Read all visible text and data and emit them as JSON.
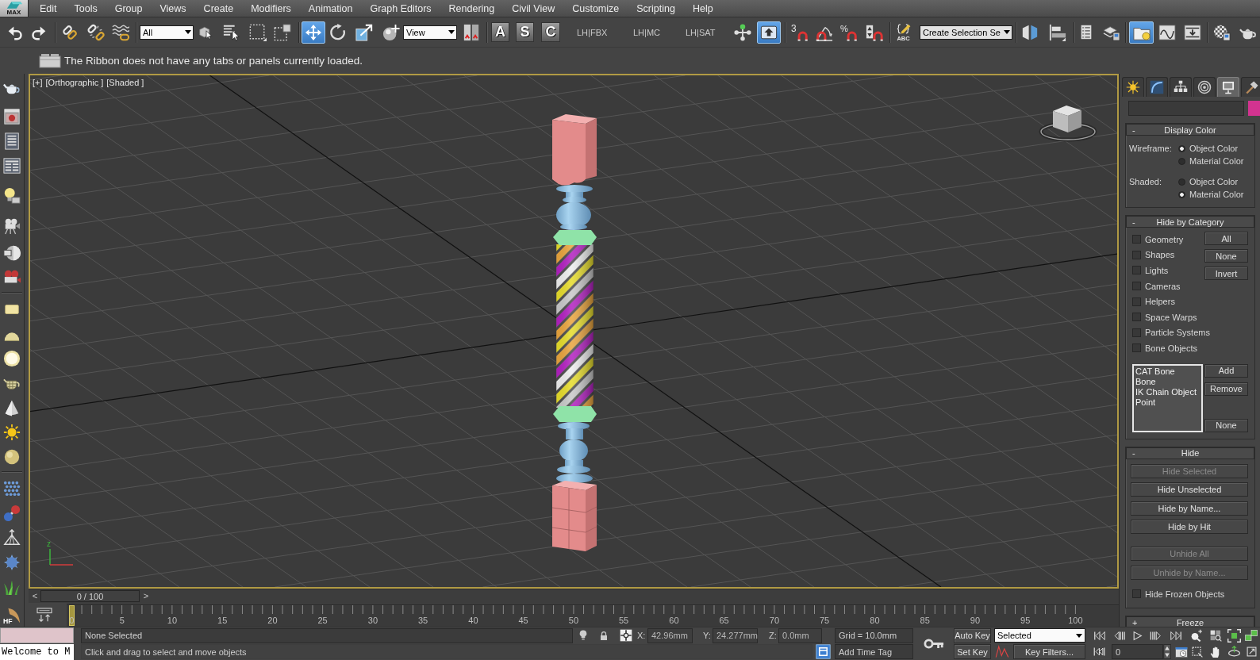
{
  "app_logo": "MAX",
  "menu_bar": [
    "Edit",
    "Tools",
    "Group",
    "Views",
    "Create",
    "Modifiers",
    "Animation",
    "Graph Editors",
    "Rendering",
    "Civil View",
    "Customize",
    "Scripting",
    "Help"
  ],
  "main_toolbar": [
    {
      "kind": "button",
      "active": false
    },
    {
      "kind": "button",
      "active": false
    },
    {
      "kind": "separator"
    },
    {
      "kind": "button",
      "active": false
    },
    {
      "kind": "button",
      "active": false
    },
    {
      "kind": "button",
      "active": false
    },
    {
      "kind": "separator"
    },
    {
      "kind": "dropdown",
      "value": "All"
    },
    {
      "kind": "button",
      "active": false
    },
    {
      "kind": "button",
      "active": false
    },
    {
      "kind": "button",
      "active": false
    },
    {
      "kind": "button",
      "active": false
    },
    {
      "kind": "separator"
    },
    {
      "kind": "button",
      "active": true
    },
    {
      "kind": "button",
      "active": false
    },
    {
      "kind": "button",
      "active": false
    },
    {
      "kind": "button",
      "active": false
    },
    {
      "kind": "dropdown",
      "value": "View"
    },
    {
      "kind": "button",
      "active": false
    },
    {
      "kind": "separator"
    },
    {
      "kind": "letter",
      "label": "A"
    },
    {
      "kind": "letter",
      "label": "S"
    },
    {
      "kind": "letter",
      "label": "C"
    },
    {
      "kind": "text",
      "label": "LH|FBX"
    },
    {
      "kind": "text",
      "label": "LH|MC"
    },
    {
      "kind": "text",
      "label": "LH|SAT"
    },
    {
      "kind": "button",
      "active": false
    },
    {
      "kind": "button",
      "active": true
    },
    {
      "kind": "separator"
    },
    {
      "kind": "button",
      "active": false,
      "label": "3"
    },
    {
      "kind": "button",
      "active": false
    },
    {
      "kind": "button",
      "active": false,
      "label": "%"
    },
    {
      "kind": "button",
      "active": false
    },
    {
      "kind": "separator"
    },
    {
      "kind": "button",
      "active": false,
      "label": "ABC"
    },
    {
      "kind": "dropdown",
      "value": "Create Selection Se"
    },
    {
      "kind": "separator"
    },
    {
      "kind": "button",
      "active": false
    },
    {
      "kind": "button",
      "active": false
    },
    {
      "kind": "separator"
    },
    {
      "kind": "button",
      "active": false
    },
    {
      "kind": "button",
      "active": false
    },
    {
      "kind": "separator"
    },
    {
      "kind": "button",
      "active": true
    },
    {
      "kind": "button",
      "active": false
    },
    {
      "kind": "button",
      "active": false
    },
    {
      "kind": "separator"
    },
    {
      "kind": "button",
      "active": false
    },
    {
      "kind": "button",
      "active": false
    }
  ],
  "ribbon": {
    "message": "The Ribbon does not have any tabs or panels currently loaded."
  },
  "left_toolbar": {
    "last_icon_label": "HF"
  },
  "viewport": {
    "active": true,
    "label_menus": [
      "[+]",
      "[Orthographic ]",
      "[Shaded ]"
    ],
    "axis_label": "z"
  },
  "command_panel": {
    "tabs": [
      {
        "selected": false
      },
      {
        "selected": false
      },
      {
        "selected": false
      },
      {
        "selected": false
      },
      {
        "selected": true
      },
      {
        "selected": false
      }
    ],
    "rollouts": [
      {
        "kind": "radio_groups",
        "sign": "-",
        "title": "Display Color",
        "groups": [
          {
            "label": "Wireframe:",
            "options": [
              {
                "label": "Object Color",
                "selected": true
              },
              {
                "label": "Material Color",
                "selected": false
              }
            ]
          },
          {
            "label": "Shaded:",
            "options": [
              {
                "label": "Object Color",
                "selected": false
              },
              {
                "label": "Material Color",
                "selected": true
              }
            ]
          }
        ]
      },
      {
        "kind": "category_filter",
        "sign": "-",
        "title": "Hide by Category",
        "categories": [
          {
            "label": "Geometry",
            "checked": false
          },
          {
            "label": "Shapes",
            "checked": false
          },
          {
            "label": "Lights",
            "checked": false
          },
          {
            "label": "Cameras",
            "checked": false
          },
          {
            "label": "Helpers",
            "checked": false
          },
          {
            "label": "Space Warps",
            "checked": false
          },
          {
            "label": "Particle Systems",
            "checked": false
          },
          {
            "label": "Bone Objects",
            "checked": false
          }
        ],
        "buttons": [
          "All",
          "None",
          "Invert"
        ],
        "list_items": [
          "CAT Bone",
          "Bone",
          "IK Chain Object",
          "Point"
        ],
        "list_button_groups": [
          [
            "Add",
            "Remove"
          ],
          [
            "None"
          ]
        ]
      },
      {
        "kind": "button_list",
        "sign": "-",
        "title": "Hide",
        "button_groups": [
          [
            {
              "label": "Hide Selected",
              "disabled": true
            },
            {
              "label": "Hide Unselected",
              "disabled": false
            },
            {
              "label": "Hide by Name...",
              "disabled": false
            },
            {
              "label": "Hide by Hit",
              "disabled": false
            }
          ],
          [
            {
              "label": "Unhide All",
              "disabled": true
            },
            {
              "label": "Unhide by Name...",
              "disabled": true
            }
          ]
        ],
        "option": {
          "label": "Hide Frozen Objects",
          "checked": false
        }
      },
      {
        "kind": "collapsed",
        "sign": "+",
        "title": "Freeze"
      }
    ]
  },
  "time_slider": {
    "prev": "<",
    "label": "0 / 100",
    "next": ">",
    "level": 0
  },
  "track_bar": {
    "frame_labels": [
      "0",
      "5",
      "10",
      "15",
      "20",
      "25",
      "30",
      "35",
      "40",
      "45",
      "50",
      "55",
      "60",
      "65",
      "70",
      "75",
      "80",
      "85",
      "90",
      "95",
      "100"
    ]
  },
  "status_bar": {
    "listener_output": "Welcome to M",
    "selection": "None Selected",
    "prompt": "Click and drag to select and move objects",
    "coordinates": [
      {
        "axis": "X:",
        "value": "42.96mm"
      },
      {
        "axis": "Y:",
        "value": "24.277mm"
      },
      {
        "axis": "Z:",
        "value": "0.0mm"
      }
    ],
    "grid": "Grid = 10.0mm",
    "time_tag": "Add Time Tag",
    "auto_key": {
      "label": "Auto Key",
      "on": false
    },
    "key_mode": "Selected",
    "set_key": "Set Key",
    "key_filters": "Key Filters...",
    "current_frame": "0"
  }
}
